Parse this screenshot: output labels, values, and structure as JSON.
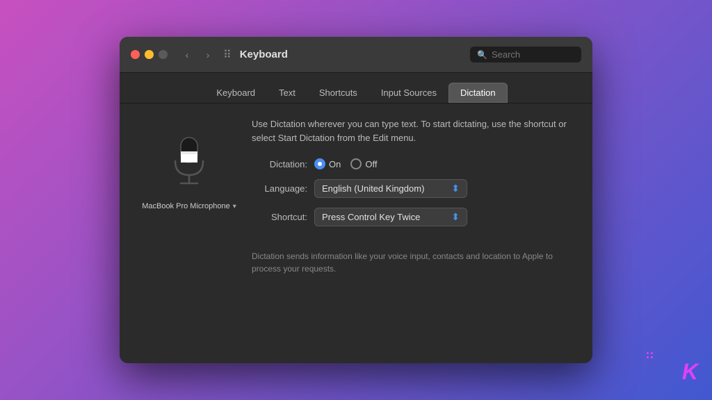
{
  "background": {
    "gradient_start": "#c850c0",
    "gradient_end": "#4158d0"
  },
  "window": {
    "title": "Keyboard"
  },
  "title_bar": {
    "title": "Keyboard",
    "search_placeholder": "Search",
    "nav_back": "‹",
    "nav_forward": "›"
  },
  "tabs": [
    {
      "id": "keyboard",
      "label": "Keyboard",
      "active": false
    },
    {
      "id": "text",
      "label": "Text",
      "active": false
    },
    {
      "id": "shortcuts",
      "label": "Shortcuts",
      "active": false
    },
    {
      "id": "input-sources",
      "label": "Input Sources",
      "active": false
    },
    {
      "id": "dictation",
      "label": "Dictation",
      "active": true
    }
  ],
  "content": {
    "description": "Use Dictation wherever you can type text. To start dictating,\nuse the shortcut or select Start Dictation from the Edit menu.",
    "mic_label": "MacBook Pro Microphone",
    "form": {
      "dictation_label": "Dictation:",
      "dictation_on": "On",
      "dictation_off": "Off",
      "language_label": "Language:",
      "language_value": "English (United Kingdom)",
      "shortcut_label": "Shortcut:",
      "shortcut_value": "Press Control Key Twice"
    },
    "footer_note": "Dictation sends information like your voice input, contacts and\nlocation to Apple to process your requests."
  }
}
